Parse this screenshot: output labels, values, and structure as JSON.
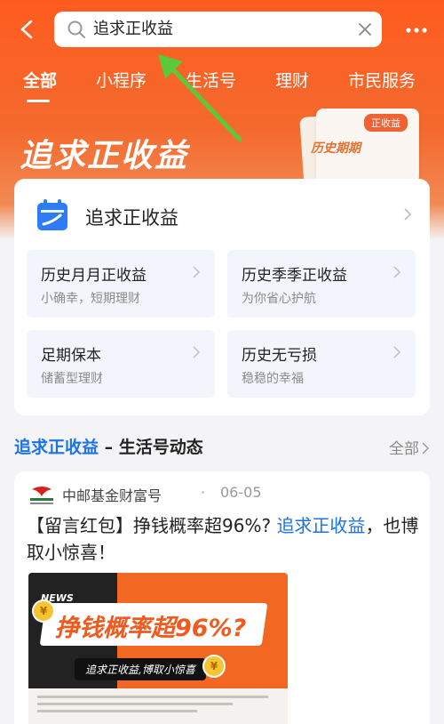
{
  "colors": {
    "accent": "#ff5b1f",
    "link": "#1a73e8"
  },
  "topbar": {
    "back_icon": "chevron-left-icon",
    "search_value": "追求正收益",
    "clear_icon": "close-icon",
    "more_icon": "more-dots-icon"
  },
  "tabs": [
    {
      "label": "全部",
      "active": true
    },
    {
      "label": "小程序"
    },
    {
      "label": "生活号"
    },
    {
      "label": "理财"
    },
    {
      "label": "市民服务"
    }
  ],
  "banner": {
    "title": "追求正收益",
    "deco_label": "历史期期",
    "deco_badge": "正收益"
  },
  "card": {
    "title": "追求正收益",
    "items": [
      {
        "title": "历史月月正收益",
        "subtitle": "小确幸，短期理财"
      },
      {
        "title": "历史季季正收益",
        "subtitle": "为你省心护航"
      },
      {
        "title": "足期保本",
        "subtitle": "储蓄型理财"
      },
      {
        "title": "历史无亏损",
        "subtitle": "稳稳的幸福"
      }
    ]
  },
  "section": {
    "keyword": "追求正收益",
    "rest": " – 生活号动态",
    "all_label": "全部"
  },
  "post": {
    "author": "中邮基金财富号",
    "dot": "·",
    "date": "06-05",
    "headline_pre": "【留言红包】挣钱概率超96%? ",
    "headline_kw": "追求正收益",
    "headline_post": "，也博取小惊喜！",
    "thumb": {
      "news": "NEWS",
      "big": "挣钱概率超96%?",
      "pill": "追求正收益,博取小惊喜",
      "coin": "¥"
    }
  }
}
